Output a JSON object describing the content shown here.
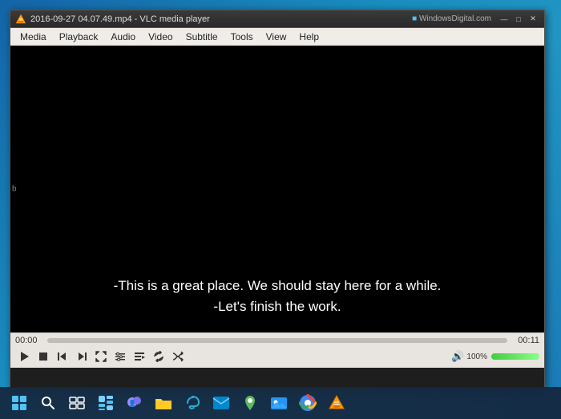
{
  "desktop": {
    "background": "#1a8fc1"
  },
  "window": {
    "title": "2016-09-27 04.07.49.mp4 - VLC media player",
    "icon": "vlc-icon"
  },
  "watermark": "WindowsDigital.com",
  "titlebar": {
    "minimize_label": "—",
    "maximize_label": "□",
    "close_label": "✕"
  },
  "menubar": {
    "items": [
      {
        "id": "media",
        "label": "Media"
      },
      {
        "id": "playback",
        "label": "Playback"
      },
      {
        "id": "audio",
        "label": "Audio"
      },
      {
        "id": "video",
        "label": "Video"
      },
      {
        "id": "subtitle",
        "label": "Subtitle"
      },
      {
        "id": "tools",
        "label": "Tools"
      },
      {
        "id": "view",
        "label": "View"
      },
      {
        "id": "help",
        "label": "Help"
      }
    ]
  },
  "video": {
    "subtitle_line1": "-This is a great place. We should stay here for a while.",
    "subtitle_line2": "-Let's finish the work."
  },
  "controls": {
    "time_current": "00:00",
    "time_total": "00:11",
    "volume_percent": "100%",
    "progress_percent": 0
  },
  "taskbar": {
    "icons": [
      {
        "id": "windows-start",
        "label": "⊞",
        "tooltip": "Start"
      },
      {
        "id": "search",
        "label": "🔍",
        "tooltip": "Search"
      },
      {
        "id": "task-view",
        "label": "⧉",
        "tooltip": "Task View"
      },
      {
        "id": "widgets",
        "label": "▦",
        "tooltip": "Widgets"
      },
      {
        "id": "teams-chat",
        "label": "💬",
        "tooltip": "Chat"
      },
      {
        "id": "file-explorer",
        "label": "📁",
        "tooltip": "File Explorer"
      },
      {
        "id": "edge",
        "label": "e",
        "tooltip": "Microsoft Edge"
      },
      {
        "id": "mail",
        "label": "✉",
        "tooltip": "Mail"
      },
      {
        "id": "maps",
        "label": "📍",
        "tooltip": "Maps"
      },
      {
        "id": "photos",
        "label": "🖼",
        "tooltip": "Photos"
      },
      {
        "id": "chrome",
        "label": "◉",
        "tooltip": "Chrome"
      },
      {
        "id": "vlc",
        "label": "▶",
        "tooltip": "VLC"
      }
    ]
  }
}
